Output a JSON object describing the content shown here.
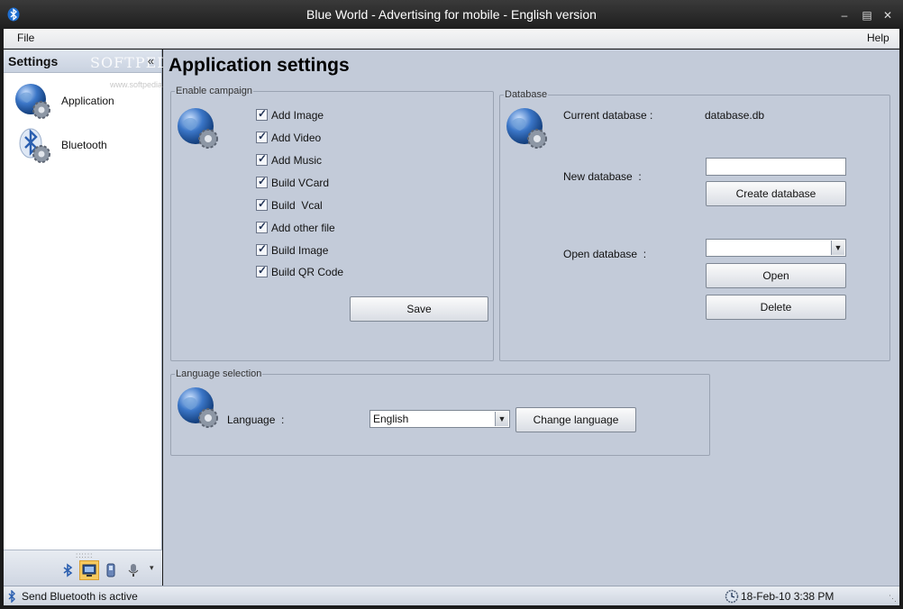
{
  "window": {
    "title": "Blue World - Advertising for mobile - English version"
  },
  "menu": {
    "file": "File",
    "help": "Help"
  },
  "sidebar": {
    "title": "Settings",
    "watermark": "SOFTPEDIA",
    "watermark_url": "www.softpedia.com",
    "items": [
      {
        "label": "Application",
        "icon": "globe-gear-icon"
      },
      {
        "label": "Bluetooth",
        "icon": "bluetooth-gear-icon"
      }
    ]
  },
  "main": {
    "page_title": "Application settings",
    "campaign": {
      "legend": "Enable campaign",
      "options": [
        {
          "label": "Add Image",
          "checked": true
        },
        {
          "label": "Add Video",
          "checked": true
        },
        {
          "label": "Add Music",
          "checked": true
        },
        {
          "label": "Build VCard",
          "checked": true
        },
        {
          "label": "Build  Vcal",
          "checked": true
        },
        {
          "label": "Add other file",
          "checked": true
        },
        {
          "label": "Build Image",
          "checked": true
        },
        {
          "label": "Build QR Code",
          "checked": true
        }
      ],
      "save_label": "Save"
    },
    "database": {
      "legend": "Database",
      "current_label": "Current database :",
      "current_value": "database.db",
      "new_label": "New database  :",
      "new_value": "",
      "create_label": "Create database",
      "open_label": "Open database  :",
      "open_value": "",
      "open_button": "Open",
      "delete_button": "Delete"
    },
    "language": {
      "legend": "Language selection",
      "label": "Language  :",
      "selected": "English",
      "change_button": "Change language"
    }
  },
  "status": {
    "message": "Send Bluetooth is active",
    "datetime": "18-Feb-10 3:38 PM"
  },
  "colors": {
    "accent_blue": "#2b5fb0",
    "panel_bg": "#c3cbd9",
    "selected_tool": "#f6c95e"
  }
}
